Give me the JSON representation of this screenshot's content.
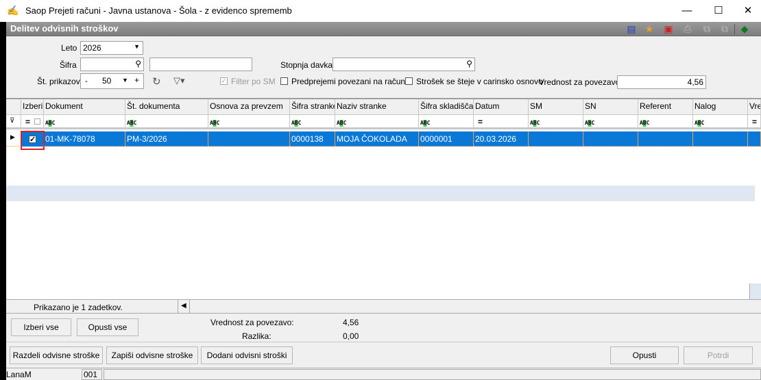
{
  "window": {
    "title": "Saop Prejeti računi - Javna ustanova - Šola - z evidenco sprememb",
    "minimize": "—",
    "maximize": "☐",
    "close": "✕"
  },
  "form": {
    "title": "Delitev odvisnih stroškov",
    "leto_label": "Leto",
    "leto_value": "2026",
    "sifra_label": "Šifra",
    "sifra_value": "",
    "sifra_name_value": "",
    "stopnja_label": "Stopnja davka",
    "stopnja_value": "",
    "st_prikazov_label": "Št. prikazov",
    "st_prikazov_value": "50",
    "minus": "-",
    "plus": "+",
    "filter_sm_label": "Filter po SM",
    "filter_sm_checked": true,
    "predprejemi_label": "Predprejemi povezani na račun",
    "predprejemi_checked": false,
    "strosek_label": "Strošek se šteje v carinsko osnovo",
    "strosek_checked": false,
    "vrednost_label": "Vrednost za povezavo",
    "vrednost_value": "4,56"
  },
  "grid": {
    "columns": [
      "Izberi",
      "Dokument",
      "Št. dokumenta",
      "Osnova za prevzem",
      "Šifra stranke",
      "Naziv stranke",
      "Šifra skladišča",
      "Datum",
      "SM",
      "SN",
      "Referent",
      "Nalog",
      "Vre"
    ],
    "filters": [
      "=",
      "ABC",
      "ABC",
      "ABC",
      "ABC",
      "ABC",
      "ABC",
      "=",
      "ABC",
      "ABC",
      "ABC",
      "ABC",
      "="
    ],
    "rows": [
      {
        "izberi": true,
        "cells": [
          "",
          "01-MK-78078",
          "PM-3/2026",
          "",
          "0000138",
          "MOJA ČOKOLADA",
          "0000001",
          "20.03.2026",
          "",
          "",
          "",
          "",
          ""
        ]
      }
    ],
    "status": "Prikazano je 1 zadetkov."
  },
  "summary": {
    "vrednost_label": "Vrednost za povezavo:",
    "vrednost_value": "4,56",
    "razlika_label": "Razlika:",
    "razlika_value": "0,00"
  },
  "buttons": {
    "izberi_vse": "Izberi vse",
    "opusti_vse": "Opusti vse",
    "razdeli": "Razdeli odvisne stroške",
    "zapisi": "Zapiši odvisne stroške",
    "dodani": "Dodani odvisni stroški",
    "opusti": "Opusti",
    "potrdi": "Potrdi"
  },
  "statusbar": {
    "user": "LanaM",
    "code": "001"
  }
}
